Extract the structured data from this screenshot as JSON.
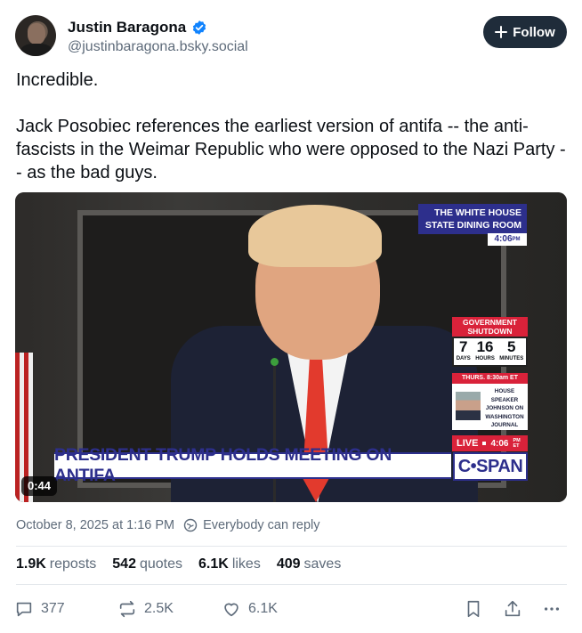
{
  "author": {
    "display_name": "Justin Baragona",
    "handle": "@justinbaragona.bsky.social"
  },
  "follow_button": {
    "label": "Follow"
  },
  "post": {
    "paragraphs": [
      "Incredible.",
      "Jack Posobiec references the earliest version of antifa -- the anti-fascists in the Weimar Republic who were opposed to the Nazi Party -- as the bad guys."
    ]
  },
  "video": {
    "duration": "0:44",
    "location_line1": "THE WHITE HOUSE",
    "location_line2": "STATE DINING ROOM",
    "time": "4:06",
    "time_suffix": "PM",
    "shutdown_line1": "GOVERNMENT",
    "shutdown_line2": "SHUTDOWN",
    "counter": [
      {
        "value": "7",
        "label": "DAYS"
      },
      {
        "value": "16",
        "label": "HOURS"
      },
      {
        "value": "5",
        "label": "MINUTES"
      }
    ],
    "thurs_header": "THURS. 8:30am ET",
    "thurs_text": [
      "HOUSE",
      "SPEAKER",
      "JOHNSON ON",
      "WASHINGTON",
      "JOURNAL"
    ],
    "live_label": "LIVE",
    "live_time": "4:06",
    "live_tz_line1": "PM",
    "live_tz_line2": "ET",
    "headline": "PRESIDENT TRUMP HOLDS MEETING ON ANTIFA",
    "network": "C•SPAN"
  },
  "meta": {
    "timestamp": "October 8, 2025 at 1:16 PM",
    "reply_permission": "Everybody can reply"
  },
  "stats": {
    "reposts_count": "1.9K",
    "reposts_label": "reposts",
    "quotes_count": "542",
    "quotes_label": "quotes",
    "likes_count": "6.1K",
    "likes_label": "likes",
    "saves_count": "409",
    "saves_label": "saves"
  },
  "actions": {
    "reply_count": "377",
    "repost_count": "2.5K",
    "like_count": "6.1K"
  },
  "colors": {
    "accent": "#1f2c3a",
    "verified": "#1083fe",
    "muted": "#5e6b7a",
    "cspan_blue": "#2d2f8c",
    "cspan_red": "#d9223a"
  }
}
